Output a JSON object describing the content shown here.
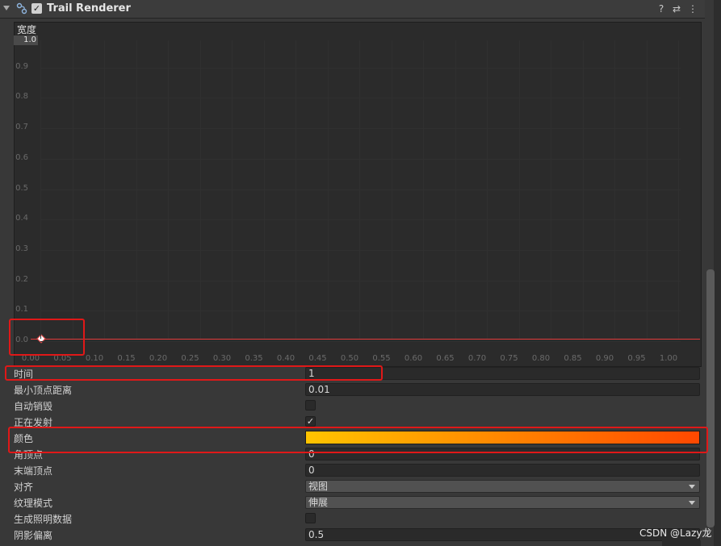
{
  "header": {
    "title": "Trail Renderer",
    "enabled_check": "✓",
    "help_icon": "?",
    "presets_icon": "⇄",
    "menu_icon": "⋮"
  },
  "curve": {
    "label": "宽度",
    "max_value": "1.0",
    "y_ticks": [
      "0.9",
      "0.8",
      "0.7",
      "0.6",
      "0.5",
      "0.4",
      "0.3",
      "0.2",
      "0.1",
      "0.0"
    ],
    "x_ticks": [
      "0.00",
      "0.05",
      "0.10",
      "0.15",
      "0.20",
      "0.25",
      "0.30",
      "0.35",
      "0.40",
      "0.45",
      "0.50",
      "0.55",
      "0.60",
      "0.65",
      "0.70",
      "0.75",
      "0.80",
      "0.85",
      "0.90",
      "0.95",
      "1.00"
    ],
    "curve_color": "#e23a3a"
  },
  "properties": {
    "time": {
      "label": "时间",
      "value": "1"
    },
    "min_vertex_distance": {
      "label": "最小顶点距离",
      "value": "0.01"
    },
    "autodestruct": {
      "label": "自动销毁",
      "checked": ""
    },
    "emitting": {
      "label": "正在发射",
      "checked": "✓"
    },
    "color": {
      "label": "颜色",
      "gradient_start": "#ffc400",
      "gradient_end": "#ff4800"
    },
    "corner_vertices": {
      "label": "角顶点",
      "value": "0"
    },
    "end_cap_vertices": {
      "label": "末端顶点",
      "value": "0"
    },
    "alignment": {
      "label": "对齐",
      "value": "视图"
    },
    "texture_mode": {
      "label": "纹理模式",
      "value": "伸展"
    },
    "generate_lighting_data": {
      "label": "生成照明数据",
      "checked": ""
    },
    "shadow_bias": {
      "label": "阴影偏离",
      "value": "0.5"
    }
  },
  "highlight_color": "#e01818",
  "watermark": "CSDN @Lazy龙"
}
